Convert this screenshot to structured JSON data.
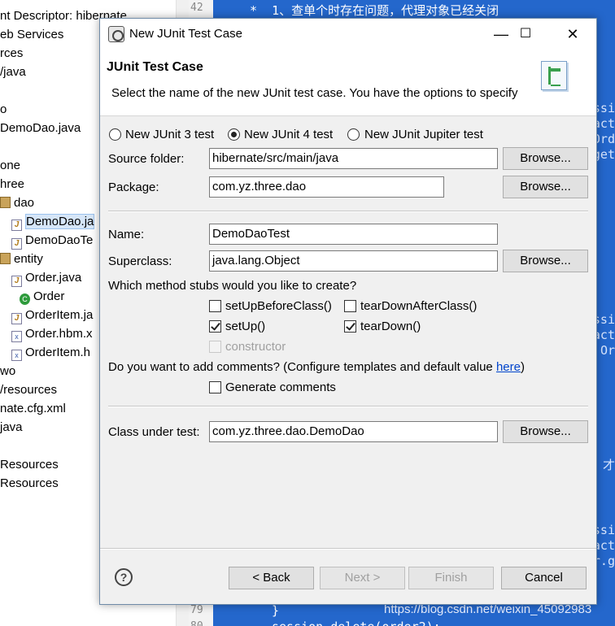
{
  "explorer": {
    "items": [
      {
        "text": "nt Descriptor: hibernate",
        "icon": "none"
      },
      {
        "text": "eb Services",
        "icon": "none"
      },
      {
        "text": "rces",
        "icon": "none"
      },
      {
        "text": "/java",
        "icon": "none"
      },
      {
        "text": "",
        "icon": "none"
      },
      {
        "text": "o",
        "icon": "none"
      },
      {
        "text": "DemoDao.java",
        "icon": "none"
      },
      {
        "text": "",
        "icon": "none"
      },
      {
        "text": "one",
        "icon": "none"
      },
      {
        "text": "hree",
        "icon": "none"
      },
      {
        "text": "dao",
        "icon": "package-icon"
      },
      {
        "text": "DemoDao.ja",
        "icon": "java-file-icon"
      },
      {
        "text": "DemoDaoTe",
        "icon": "java-file-icon"
      },
      {
        "text": "entity",
        "icon": "package-icon"
      },
      {
        "text": "Order.java",
        "icon": "java-file-icon"
      },
      {
        "text": "Order",
        "icon": "class-icon"
      },
      {
        "text": "OrderItem.ja",
        "icon": "java-file-icon"
      },
      {
        "text": "Order.hbm.x",
        "icon": "xml-file-icon"
      },
      {
        "text": "OrderItem.h",
        "icon": "xml-file-icon"
      },
      {
        "text": "wo",
        "icon": "none"
      },
      {
        "text": "/resources",
        "icon": "none"
      },
      {
        "text": "nate.cfg.xml",
        "icon": "none"
      },
      {
        "text": "java",
        "icon": "none"
      },
      {
        "text": "",
        "icon": "none"
      },
      {
        "text": "Resources",
        "icon": "none"
      },
      {
        "text": "Resources",
        "icon": "none"
      }
    ]
  },
  "editor": {
    "line_numbers": [
      "42",
      "79",
      "80"
    ],
    "comment_line": " *  1、查单个时存在问题，代理对象已经关闭",
    "brace_line": "}",
    "last_line": "session.delete(order2);",
    "right_fragments": [
      "ssi",
      "act",
      "Ord",
      "get",
      "ssi",
      "act",
      "Or",
      "才",
      "ssi",
      "act",
      "r.g"
    ],
    "watermark": "https://blog.csdn.net/weixin_45092983"
  },
  "dialog": {
    "title": "New JUnit Test Case",
    "window_controls": {
      "minimize": "—",
      "maximize": "☐",
      "close": "✕"
    },
    "banner": {
      "title": "JUnit Test Case",
      "description": "Select the name of the new JUnit test case. You have the options to specify"
    },
    "radios": [
      {
        "label": "New JUnit 3 test",
        "selected": false
      },
      {
        "label": "New JUnit 4 test",
        "selected": true
      },
      {
        "label": "New JUnit Jupiter test",
        "selected": false
      }
    ],
    "source_folder": {
      "label": "Source folder:",
      "value": "hibernate/src/main/java",
      "browse": "Browse..."
    },
    "package": {
      "label": "Package:",
      "value": "com.yz.three.dao",
      "browse": "Browse..."
    },
    "name": {
      "label": "Name:",
      "value": "DemoDaoTest"
    },
    "superclass": {
      "label": "Superclass:",
      "value": "java.lang.Object",
      "browse": "Browse..."
    },
    "stubs_question": "Which method stubs would you like to create?",
    "stubs": {
      "setUpBeforeClass": {
        "label": "setUpBeforeClass()",
        "checked": false
      },
      "tearDownAfterClass": {
        "label": "tearDownAfterClass()",
        "checked": false
      },
      "setUp": {
        "label": "setUp()",
        "checked": true
      },
      "tearDown": {
        "label": "tearDown()",
        "checked": true
      },
      "constructor": {
        "label": "constructor",
        "checked": false,
        "enabled": false
      }
    },
    "comments_question": "Do you want to add comments? (Configure templates and default value ",
    "comments_link": "here",
    "comments_close": ")",
    "generate_comments": {
      "label": "Generate comments",
      "checked": false
    },
    "class_under_test": {
      "label": "Class under test:",
      "value": "com.yz.three.dao.DemoDao",
      "browse": "Browse..."
    },
    "footer": {
      "help": "?",
      "back": "< Back",
      "next": "Next >",
      "finish": "Finish",
      "cancel": "Cancel"
    }
  }
}
